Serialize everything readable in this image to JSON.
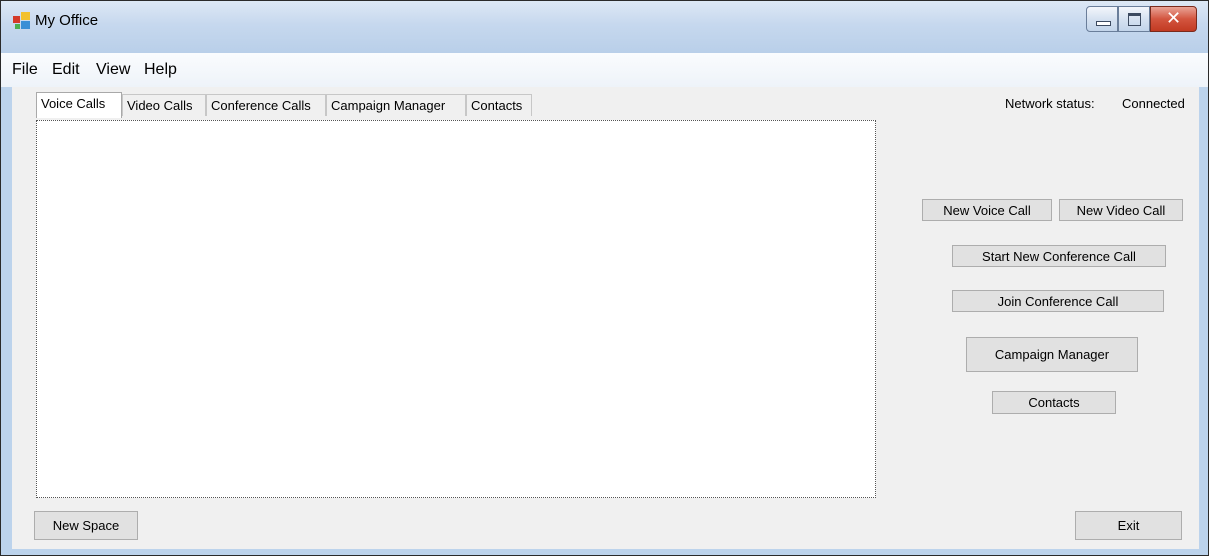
{
  "window": {
    "title": "My Office"
  },
  "menu": [
    "File",
    "Edit",
    "View",
    "Help"
  ],
  "tabs": [
    "Voice Calls",
    "Video Calls",
    "Conference Calls",
    "Campaign Manager",
    "Contacts"
  ],
  "active_tab": "Voice Calls",
  "network": {
    "label": "Network status:",
    "value": "Connected"
  },
  "buttons": {
    "new_voice_call": "New Voice Call",
    "new_video_call": "New Video Call",
    "start_conference": "Start New Conference  Call",
    "join_conference": "Join Conference  Call",
    "campaign_manager": "Campaign Manager",
    "contacts": "Contacts",
    "new_space": "New Space",
    "exit": "Exit"
  }
}
